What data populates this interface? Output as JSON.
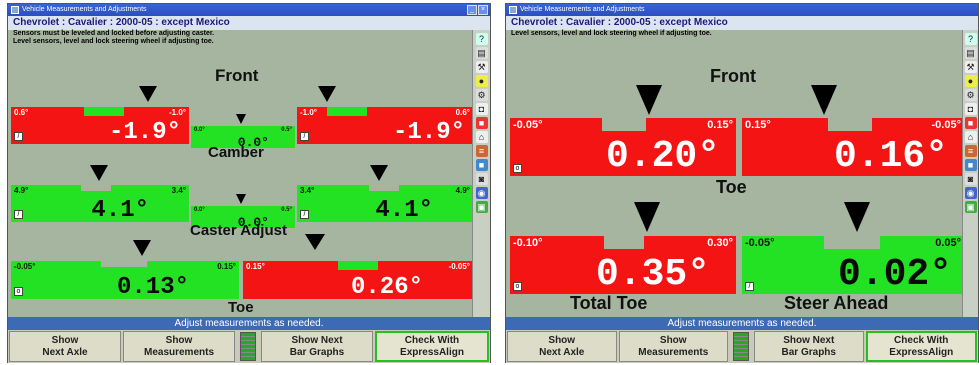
{
  "left": {
    "title": "Vehicle Measurements and Adjustments",
    "vehicle": "Chevrolet : Cavalier : 2000-05 : except Mexico",
    "instructions": [
      "Sensors must be leveled and locked before adjusting caster.",
      "Level sensors, level and lock steering wheel if adjusting toe."
    ],
    "front_label": "Front",
    "camber_label": "Camber",
    "caster_label": "Caster Adjust",
    "toe_label": "Toe",
    "camber_left": {
      "min": "0.6°",
      "max": "-1.0°",
      "value": "-1.9°",
      "status": "red"
    },
    "camber_cross": {
      "min": "0.0°",
      "max": "0.5°",
      "value": "0.0°",
      "status": "green"
    },
    "camber_right": {
      "min": "-1.0°",
      "max": "0.6°",
      "value": "-1.9°",
      "status": "red"
    },
    "caster_left": {
      "min": "4.9°",
      "max": "3.4°",
      "value": "4.1°",
      "status": "green"
    },
    "caster_cross": {
      "min": "0.0°",
      "max": "0.5°",
      "value": "0.0°",
      "status": "green"
    },
    "caster_right": {
      "min": "3.4°",
      "max": "4.9°",
      "value": "4.1°",
      "status": "green"
    },
    "toe_left": {
      "min": "-0.05°",
      "max": "0.15°",
      "value": "0.13°",
      "status": "green"
    },
    "toe_right": {
      "min": "0.15°",
      "max": "-0.05°",
      "value": "0.26°",
      "status": "red"
    }
  },
  "right": {
    "title": "Vehicle Measurements and Adjustments",
    "vehicle": "Chevrolet : Cavalier : 2000-05 : except Mexico",
    "instructions": [
      "Level sensors, level and lock steering wheel if adjusting toe."
    ],
    "front_label": "Front",
    "toe_label": "Toe",
    "total_toe_label": "Total Toe",
    "steer_ahead_label": "Steer Ahead",
    "toe_left": {
      "min": "-0.05°",
      "max": "0.15°",
      "value": "0.20°",
      "status": "red"
    },
    "toe_right": {
      "min": "0.15°",
      "max": "-0.05°",
      "value": "0.16°",
      "status": "red"
    },
    "total_toe": {
      "min": "-0.10°",
      "max": "0.30°",
      "value": "0.35°",
      "status": "red"
    },
    "steer_ahead": {
      "min": "-0.05°",
      "max": "0.05°",
      "value": "0.02°",
      "status": "green"
    }
  },
  "status_text": "Adjust measurements as needed.",
  "buttons": {
    "next_axle": "Show\nNext Axle",
    "measurements": "Show\nMeasurements",
    "next_bar": "Show Next\nBar Graphs",
    "express": "Check With\nExpressAlign"
  },
  "colors": {
    "out_of_spec": "#f41414",
    "in_spec": "#23e223",
    "status_bar": "#3d6ab5"
  },
  "sidebar_icons": [
    "help-icon",
    "print-icon",
    "tools-icon",
    "yellow-icon",
    "wrench-icon",
    "camera-icon",
    "red-icon",
    "home-icon",
    "graph-icon",
    "blue-icon",
    "camera2-icon",
    "globe-icon",
    "tire-icon"
  ]
}
